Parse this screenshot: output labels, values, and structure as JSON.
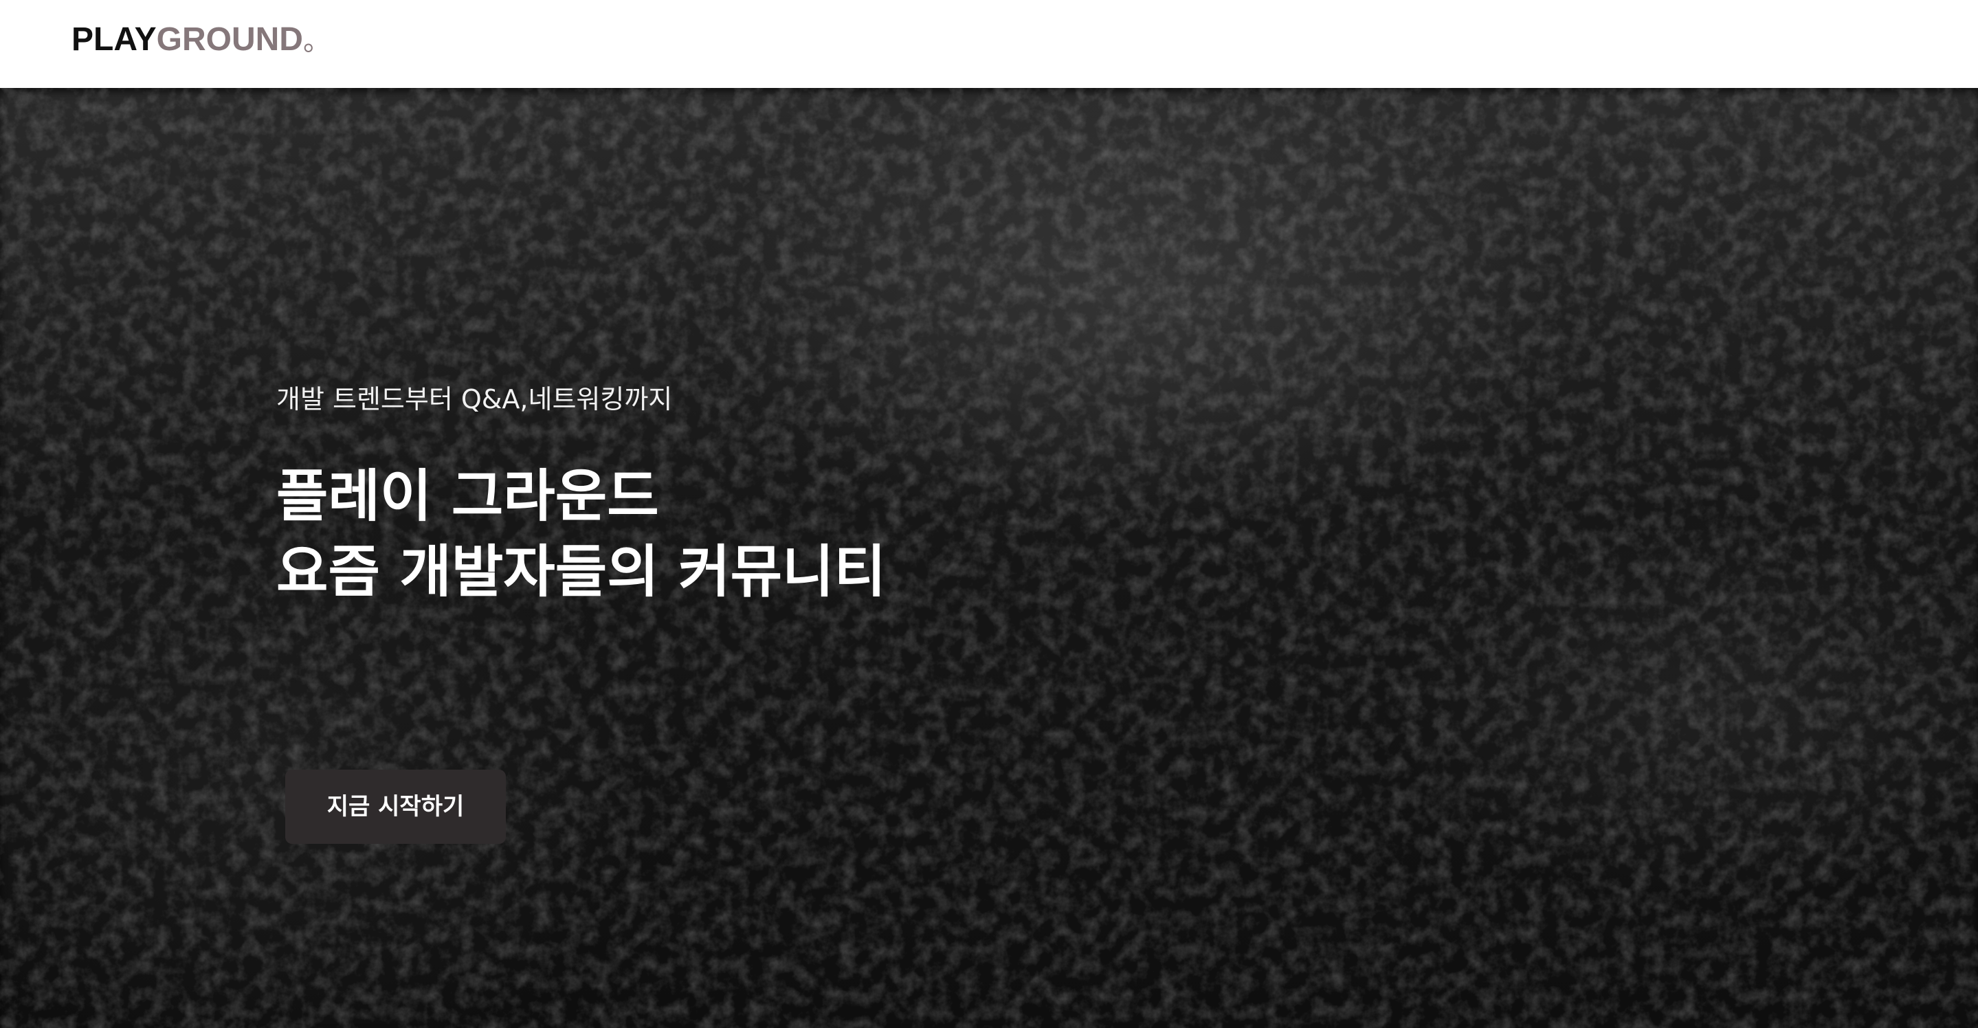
{
  "header": {
    "logo": {
      "part1": "PLAY",
      "part2": "GROUND",
      "part3": "。"
    }
  },
  "hero": {
    "subtitle": "개발 트렌드부터 Q&A,네트워킹까지",
    "title_line1": "플레이 그라운드",
    "title_line2": "요즘 개발자들의 커뮤니티",
    "cta_label": "지금 시작하기"
  },
  "colors": {
    "logo_dark": "#111111",
    "logo_accent": "#85777a",
    "hero_background": "#161616",
    "cta_background": "#2f2b2c",
    "text_light": "#ffffff"
  },
  "icons": {
    "background": "textured-black-leather-image"
  }
}
